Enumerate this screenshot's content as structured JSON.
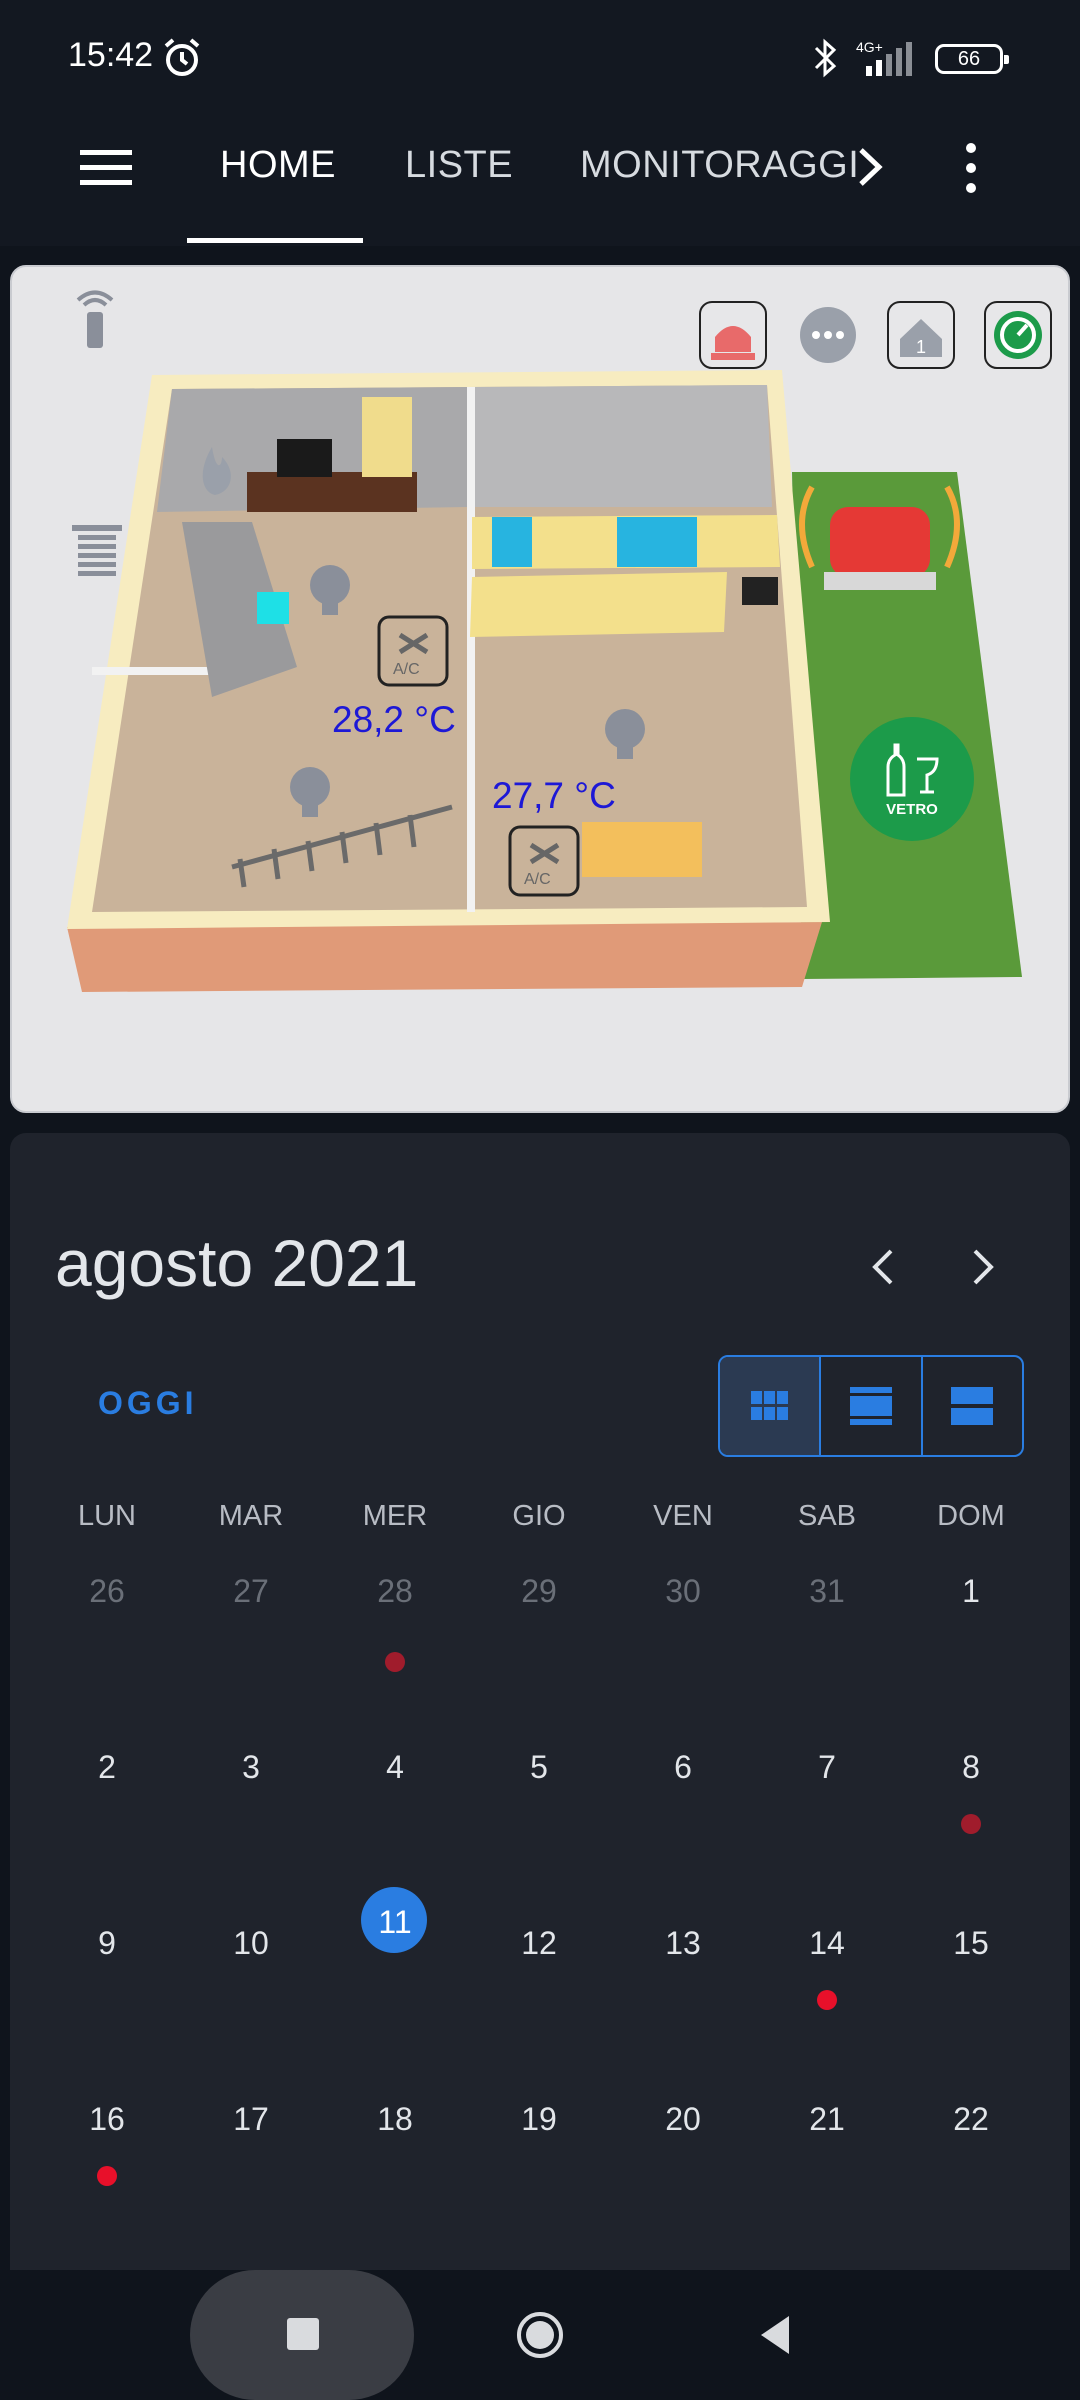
{
  "status_bar": {
    "time": "15:42",
    "network": "4G+",
    "battery": "66"
  },
  "app_bar": {
    "tabs": [
      {
        "label": "HOME",
        "active": true
      },
      {
        "label": "LISTE",
        "active": false
      },
      {
        "label": "MONITORAGGI",
        "active": false
      }
    ]
  },
  "floorplan": {
    "temperatures": [
      "28,2 °C",
      "27,7 °C"
    ],
    "ac_label": "A/C",
    "glass_bin_label": "VETRO",
    "alarm_color": "#e53935",
    "lawn_color": "#5a9a3a"
  },
  "calendar": {
    "title": "agosto 2021",
    "today_label": "OGGI",
    "weekdays": [
      "LUN",
      "MAR",
      "MER",
      "GIO",
      "VEN",
      "SAB",
      "DOM"
    ],
    "weeks": [
      [
        "26",
        "27",
        "28",
        "29",
        "30",
        "31",
        "1"
      ],
      [
        "2",
        "3",
        "4",
        "5",
        "6",
        "7",
        "8"
      ],
      [
        "9",
        "10",
        "11",
        "12",
        "13",
        "14",
        "15"
      ],
      [
        "16",
        "17",
        "18",
        "19",
        "20",
        "21",
        "22"
      ]
    ],
    "selected_day": "11",
    "accent_color": "#2a7de1",
    "event_dot_color_dark": "#a01c2c",
    "event_dot_color_bright": "#e8102a"
  }
}
